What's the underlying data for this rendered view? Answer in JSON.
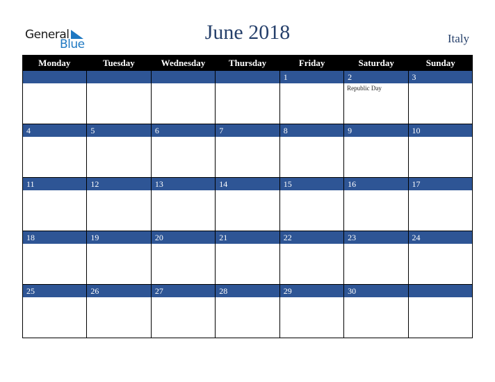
{
  "logo": {
    "word1": "General",
    "word2": "Blue"
  },
  "title": "June 2018",
  "country": "Italy",
  "colors": {
    "title": "#26406b",
    "band": "#2e5595",
    "header_bg": "#000000",
    "logo_blue": "#1e78c2"
  },
  "weekdays": [
    "Monday",
    "Tuesday",
    "Wednesday",
    "Thursday",
    "Friday",
    "Saturday",
    "Sunday"
  ],
  "weeks": [
    [
      {
        "d": ""
      },
      {
        "d": ""
      },
      {
        "d": ""
      },
      {
        "d": ""
      },
      {
        "d": "1"
      },
      {
        "d": "2",
        "event": "Republic Day"
      },
      {
        "d": "3"
      }
    ],
    [
      {
        "d": "4"
      },
      {
        "d": "5"
      },
      {
        "d": "6"
      },
      {
        "d": "7"
      },
      {
        "d": "8"
      },
      {
        "d": "9"
      },
      {
        "d": "10"
      }
    ],
    [
      {
        "d": "11"
      },
      {
        "d": "12"
      },
      {
        "d": "13"
      },
      {
        "d": "14"
      },
      {
        "d": "15"
      },
      {
        "d": "16"
      },
      {
        "d": "17"
      }
    ],
    [
      {
        "d": "18"
      },
      {
        "d": "19"
      },
      {
        "d": "20"
      },
      {
        "d": "21"
      },
      {
        "d": "22"
      },
      {
        "d": "23"
      },
      {
        "d": "24"
      }
    ],
    [
      {
        "d": "25"
      },
      {
        "d": "26"
      },
      {
        "d": "27"
      },
      {
        "d": "28"
      },
      {
        "d": "29"
      },
      {
        "d": "30"
      },
      {
        "d": ""
      }
    ]
  ]
}
